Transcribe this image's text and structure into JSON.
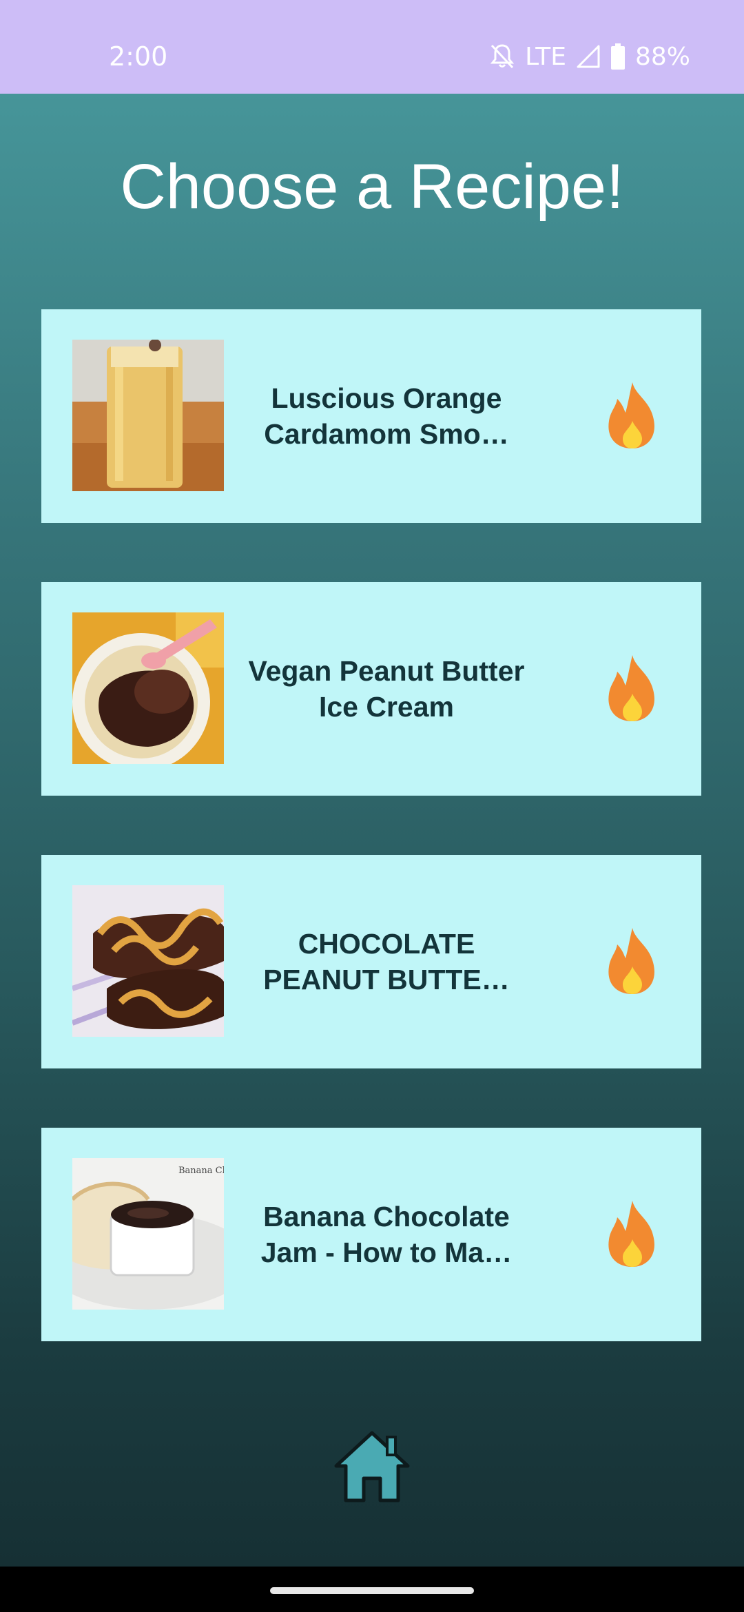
{
  "status_bar": {
    "time": "2:00",
    "network": "LTE",
    "battery": "88%",
    "icons": [
      "notifications-off-icon",
      "signal-icon",
      "battery-icon"
    ]
  },
  "page": {
    "title": "Choose a Recipe!"
  },
  "recipes": [
    {
      "title": "Luscious Orange Cardamom Smo…",
      "thumbnail": "orange-smoothie-photo",
      "icon": "fire-icon"
    },
    {
      "title": "Vegan Peanut Butter Ice Cream",
      "thumbnail": "ice-cream-photo",
      "icon": "fire-icon"
    },
    {
      "title": "CHOCOLATE PEANUT BUTTE…",
      "thumbnail": "chocolate-banana-pops-photo",
      "icon": "fire-icon"
    },
    {
      "title": "Banana Chocolate Jam - How to Ma…",
      "thumbnail": "chocolate-jam-photo",
      "thumbnail_text": "Banana Ch",
      "icon": "fire-icon"
    }
  ],
  "bottom": {
    "home_icon": "home-icon"
  },
  "colors": {
    "status_bar": "#cdbdf7",
    "card_background": "#c0f6f8",
    "card_text": "#13343a",
    "gradient_top": "#469599",
    "gradient_bottom": "#163034",
    "home_icon_fill": "#4aaab3"
  }
}
